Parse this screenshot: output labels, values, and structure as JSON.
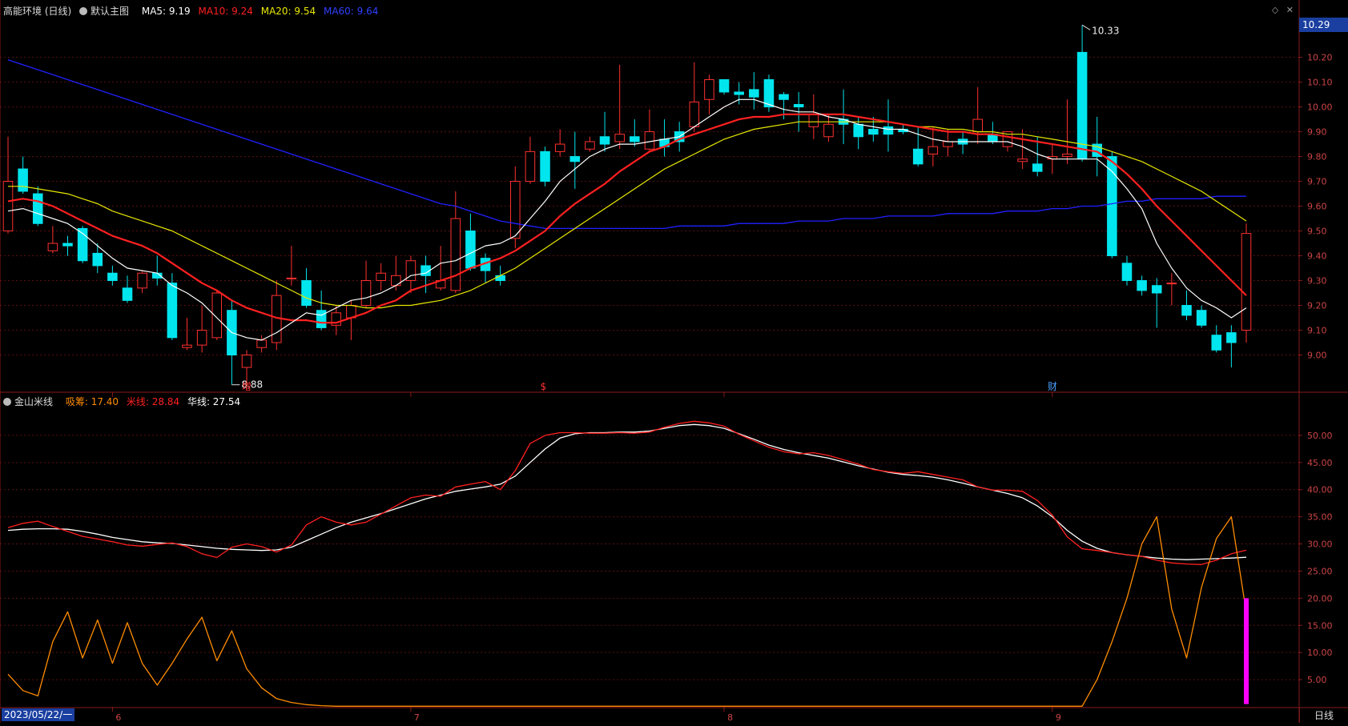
{
  "header": {
    "stock_title": "高能环境 (日线)",
    "main_chart_label": "默认主图",
    "ma5": {
      "label": "MA5: 9.19",
      "color": "#ffffff"
    },
    "ma10": {
      "label": "MA10: 9.24",
      "color": "#ff2020"
    },
    "ma20": {
      "label": "MA20: 9.54",
      "color": "#e8e800"
    },
    "ma60": {
      "label": "MA60: 9.64",
      "color": "#2020ff"
    }
  },
  "indicator_header": {
    "name": "金山米线",
    "xichou": {
      "label": "吸筹: 17.40",
      "color": "#ff8c00"
    },
    "mixian": {
      "label": "米线: 28.84",
      "color": "#ff2020"
    },
    "huaxian": {
      "label": "华线: 27.54",
      "color": "#ffffff"
    }
  },
  "price_axis_ticks": [
    "10.20",
    "10.10",
    "10.00",
    "9.90",
    "9.80",
    "9.70",
    "9.60",
    "9.50",
    "9.40",
    "9.30",
    "9.20",
    "9.10",
    "9.00"
  ],
  "indicator_axis_ticks": [
    "50.00",
    "45.00",
    "40.00",
    "35.00",
    "30.00",
    "25.00",
    "20.00",
    "15.00",
    "10.00",
    "5.00"
  ],
  "current_price_tag": "10.29",
  "annotations": {
    "high": "10.33",
    "low": "8.88"
  },
  "event_markers": [
    "增",
    "$",
    "财"
  ],
  "month_labels": [
    "6",
    "7",
    "8",
    "9"
  ],
  "date_label": "2023/05/22/一",
  "period_label": "日线",
  "colors": {
    "up": "#ff3030",
    "down": "#00e5ee",
    "grid": "#5a1010",
    "axis": "#8a1a1a",
    "bar": "#ff00ff"
  },
  "chart_data": {
    "type": "candlestick",
    "price_range": [
      8.85,
      10.36
    ],
    "candles": [
      [
        9.5,
        9.7,
        9.49,
        9.88
      ],
      [
        9.75,
        9.66,
        9.65,
        9.8
      ],
      [
        9.65,
        9.53,
        9.52,
        9.68
      ],
      [
        9.42,
        9.45,
        9.41,
        9.52
      ],
      [
        9.45,
        9.44,
        9.4,
        9.48
      ],
      [
        9.51,
        9.38,
        9.37,
        9.52
      ],
      [
        9.41,
        9.36,
        9.33,
        9.45
      ],
      [
        9.33,
        9.3,
        9.28,
        9.36
      ],
      [
        9.27,
        9.22,
        9.21,
        9.32
      ],
      [
        9.27,
        9.33,
        9.25,
        9.34
      ],
      [
        9.33,
        9.31,
        9.28,
        9.4
      ],
      [
        9.29,
        9.07,
        9.06,
        9.33
      ],
      [
        9.03,
        9.04,
        9.02,
        9.15
      ],
      [
        9.04,
        9.1,
        9.01,
        9.2
      ],
      [
        9.07,
        9.25,
        9.06,
        9.26
      ],
      [
        9.18,
        9.0,
        8.88,
        9.22
      ],
      [
        8.95,
        9.0,
        8.88,
        9.02
      ],
      [
        9.03,
        9.06,
        9.01,
        9.08
      ],
      [
        9.05,
        9.24,
        9.02,
        9.3
      ],
      [
        9.31,
        9.31,
        9.28,
        9.44
      ],
      [
        9.3,
        9.2,
        9.19,
        9.35
      ],
      [
        9.18,
        9.11,
        9.1,
        9.26
      ],
      [
        9.12,
        9.17,
        9.08,
        9.2
      ],
      [
        9.15,
        9.2,
        9.06,
        9.22
      ],
      [
        9.2,
        9.3,
        9.19,
        9.38
      ],
      [
        9.3,
        9.33,
        9.26,
        9.37
      ],
      [
        9.28,
        9.32,
        9.26,
        9.4
      ],
      [
        9.3,
        9.38,
        9.25,
        9.4
      ],
      [
        9.36,
        9.32,
        9.25,
        9.4
      ],
      [
        9.27,
        9.3,
        9.26,
        9.44
      ],
      [
        9.26,
        9.55,
        9.25,
        9.66
      ],
      [
        9.5,
        9.35,
        9.34,
        9.57
      ],
      [
        9.39,
        9.34,
        9.29,
        9.41
      ],
      [
        9.32,
        9.3,
        9.28,
        9.36
      ],
      [
        9.47,
        9.7,
        9.43,
        9.76
      ],
      [
        9.7,
        9.82,
        9.69,
        9.88
      ],
      [
        9.82,
        9.7,
        9.68,
        9.84
      ],
      [
        9.82,
        9.85,
        9.8,
        9.91
      ],
      [
        9.8,
        9.78,
        9.67,
        9.9
      ],
      [
        9.83,
        9.86,
        9.82,
        9.88
      ],
      [
        9.88,
        9.85,
        9.82,
        9.98
      ],
      [
        9.86,
        9.89,
        9.83,
        10.17
      ],
      [
        9.88,
        9.86,
        9.84,
        9.95
      ],
      [
        9.83,
        9.9,
        9.82,
        9.99
      ],
      [
        9.87,
        9.84,
        9.8,
        9.95
      ],
      [
        9.9,
        9.86,
        9.82,
        9.94
      ],
      [
        9.92,
        10.02,
        9.9,
        10.18
      ],
      [
        10.03,
        10.11,
        9.97,
        10.13
      ],
      [
        10.11,
        10.06,
        10.05,
        10.11
      ],
      [
        10.06,
        10.05,
        10.01,
        10.1
      ],
      [
        10.07,
        10.04,
        9.99,
        10.14
      ],
      [
        10.11,
        10.0,
        9.98,
        10.13
      ],
      [
        10.05,
        10.03,
        9.95,
        10.06
      ],
      [
        10.01,
        10.0,
        9.9,
        10.06
      ],
      [
        9.92,
        9.97,
        9.87,
        10.05
      ],
      [
        9.88,
        9.93,
        9.86,
        9.97
      ],
      [
        9.95,
        9.93,
        9.85,
        10.07
      ],
      [
        9.93,
        9.88,
        9.83,
        9.96
      ],
      [
        9.91,
        9.89,
        9.86,
        9.96
      ],
      [
        9.92,
        9.89,
        9.82,
        10.03
      ],
      [
        9.91,
        9.9,
        9.89,
        9.93
      ],
      [
        9.83,
        9.77,
        9.76,
        9.92
      ],
      [
        9.81,
        9.84,
        9.76,
        9.92
      ],
      [
        9.84,
        9.86,
        9.8,
        9.91
      ],
      [
        9.87,
        9.85,
        9.81,
        9.9
      ],
      [
        9.9,
        9.95,
        9.85,
        10.08
      ],
      [
        9.89,
        9.86,
        9.85,
        9.94
      ],
      [
        9.84,
        9.9,
        9.82,
        9.9
      ],
      [
        9.78,
        9.79,
        9.75,
        9.91
      ],
      [
        9.77,
        9.74,
        9.72,
        9.88
      ],
      [
        9.79,
        9.8,
        9.73,
        9.85
      ],
      [
        9.8,
        9.81,
        9.77,
        10.03
      ],
      [
        10.22,
        9.79,
        9.78,
        10.33
      ],
      [
        9.85,
        9.8,
        9.72,
        9.96
      ],
      [
        9.8,
        9.4,
        9.39,
        9.82
      ],
      [
        9.37,
        9.3,
        9.28,
        9.4
      ],
      [
        9.3,
        9.26,
        9.24,
        9.32
      ],
      [
        9.28,
        9.25,
        9.11,
        9.31
      ],
      [
        9.29,
        9.29,
        9.2,
        9.33
      ],
      [
        9.2,
        9.16,
        9.14,
        9.26
      ],
      [
        9.18,
        9.12,
        9.11,
        9.2
      ],
      [
        9.08,
        9.02,
        9.01,
        9.12
      ],
      [
        9.09,
        9.05,
        8.95,
        9.12
      ],
      [
        9.1,
        9.49,
        9.05,
        9.53
      ]
    ],
    "ma5": [
      9.58,
      9.59,
      9.57,
      9.55,
      9.53,
      9.49,
      9.44,
      9.39,
      9.35,
      9.34,
      9.33,
      9.28,
      9.25,
      9.21,
      9.15,
      9.09,
      9.07,
      9.06,
      9.09,
      9.13,
      9.17,
      9.16,
      9.19,
      9.22,
      9.23,
      9.25,
      9.28,
      9.32,
      9.33,
      9.37,
      9.38,
      9.41,
      9.44,
      9.45,
      9.48,
      9.55,
      9.62,
      9.7,
      9.75,
      9.8,
      9.83,
      9.85,
      9.85,
      9.86,
      9.87,
      9.88,
      9.92,
      9.96,
      10.0,
      10.03,
      10.03,
      10.01,
      9.99,
      9.98,
      9.98,
      9.96,
      9.95,
      9.93,
      9.92,
      9.91,
      9.91,
      9.89,
      9.87,
      9.86,
      9.86,
      9.86,
      9.86,
      9.86,
      9.84,
      9.81,
      9.79,
      9.79,
      9.79,
      9.79,
      9.74,
      9.67,
      9.59,
      9.45,
      9.35,
      9.27,
      9.22,
      9.19,
      9.15,
      9.19
    ],
    "ma10": [
      9.62,
      9.63,
      9.62,
      9.6,
      9.57,
      9.54,
      9.51,
      9.48,
      9.46,
      9.44,
      9.41,
      9.37,
      9.33,
      9.29,
      9.26,
      9.22,
      9.19,
      9.17,
      9.15,
      9.14,
      9.14,
      9.13,
      9.13,
      9.15,
      9.17,
      9.2,
      9.22,
      9.26,
      9.28,
      9.3,
      9.32,
      9.35,
      9.37,
      9.39,
      9.42,
      9.46,
      9.5,
      9.56,
      9.61,
      9.65,
      9.69,
      9.74,
      9.78,
      9.82,
      9.84,
      9.87,
      9.89,
      9.91,
      9.93,
      9.95,
      9.96,
      9.96,
      9.97,
      9.97,
      9.97,
      9.97,
      9.97,
      9.96,
      9.95,
      9.94,
      9.93,
      9.92,
      9.91,
      9.9,
      9.9,
      9.89,
      9.89,
      9.88,
      9.87,
      9.86,
      9.85,
      9.84,
      9.83,
      9.82,
      9.78,
      9.73,
      9.67,
      9.6,
      9.54,
      9.48,
      9.42,
      9.36,
      9.3,
      9.24
    ],
    "ma20": [
      9.68,
      9.68,
      9.67,
      9.66,
      9.65,
      9.63,
      9.61,
      9.58,
      9.56,
      9.54,
      9.52,
      9.5,
      9.47,
      9.44,
      9.41,
      9.38,
      9.35,
      9.32,
      9.29,
      9.26,
      9.23,
      9.21,
      9.2,
      9.2,
      9.19,
      9.19,
      9.2,
      9.2,
      9.21,
      9.22,
      9.24,
      9.26,
      9.29,
      9.32,
      9.35,
      9.39,
      9.43,
      9.47,
      9.51,
      9.55,
      9.59,
      9.63,
      9.67,
      9.71,
      9.75,
      9.78,
      9.81,
      9.84,
      9.87,
      9.89,
      9.91,
      9.92,
      9.93,
      9.94,
      9.94,
      9.94,
      9.94,
      9.94,
      9.94,
      9.94,
      9.93,
      9.92,
      9.92,
      9.91,
      9.91,
      9.9,
      9.9,
      9.89,
      9.89,
      9.88,
      9.87,
      9.86,
      9.85,
      9.84,
      9.82,
      9.8,
      9.78,
      9.75,
      9.72,
      9.69,
      9.66,
      9.62,
      9.58,
      9.54
    ],
    "ma60": [
      10.19,
      10.17,
      10.15,
      10.13,
      10.11,
      10.09,
      10.07,
      10.05,
      10.03,
      10.01,
      9.99,
      9.97,
      9.95,
      9.93,
      9.91,
      9.89,
      9.87,
      9.85,
      9.83,
      9.81,
      9.79,
      9.77,
      9.75,
      9.73,
      9.71,
      9.69,
      9.67,
      9.65,
      9.63,
      9.61,
      9.6,
      9.58,
      9.56,
      9.54,
      9.53,
      9.52,
      9.51,
      9.51,
      9.51,
      9.51,
      9.51,
      9.51,
      9.51,
      9.51,
      9.51,
      9.52,
      9.52,
      9.52,
      9.52,
      9.53,
      9.53,
      9.53,
      9.53,
      9.54,
      9.54,
      9.54,
      9.55,
      9.55,
      9.55,
      9.56,
      9.56,
      9.56,
      9.56,
      9.57,
      9.57,
      9.57,
      9.57,
      9.58,
      9.58,
      9.58,
      9.59,
      9.59,
      9.6,
      9.6,
      9.61,
      9.62,
      9.62,
      9.63,
      9.63,
      9.63,
      9.63,
      9.64,
      9.64,
      9.64
    ],
    "indicator_range": [
      0,
      55
    ],
    "mixian": [
      33.0,
      33.8,
      34.2,
      33.2,
      32.3,
      31.4,
      30.9,
      30.4,
      29.8,
      29.6,
      29.9,
      30.2,
      29.5,
      28.2,
      27.5,
      29.4,
      30.0,
      29.5,
      28.5,
      29.8,
      33.5,
      35.0,
      34.0,
      33.5,
      34.0,
      35.5,
      37.0,
      38.5,
      39.0,
      38.8,
      40.5,
      41.0,
      41.5,
      40.0,
      43.5,
      48.5,
      50.0,
      50.5,
      50.5,
      50.4,
      50.4,
      50.5,
      50.4,
      50.6,
      51.5,
      52.2,
      52.6,
      52.3,
      51.7,
      50.2,
      49.0,
      47.8,
      47.0,
      46.6,
      46.8,
      46.3,
      45.5,
      44.7,
      43.7,
      43.3,
      43.0,
      43.3,
      42.8,
      42.3,
      41.8,
      40.5,
      39.9,
      39.9,
      39.7,
      38.0,
      35.3,
      31.3,
      29.1,
      28.8,
      28.4,
      28.0,
      27.7,
      27.0,
      26.5,
      26.3,
      26.2,
      27.0,
      28.2,
      28.84
    ],
    "huaxian": [
      32.5,
      32.7,
      32.8,
      32.8,
      32.7,
      32.3,
      31.8,
      31.2,
      30.8,
      30.4,
      30.2,
      30.1,
      29.8,
      29.5,
      29.2,
      29.0,
      28.9,
      28.8,
      28.9,
      29.4,
      30.6,
      31.8,
      33.0,
      34.0,
      34.8,
      35.6,
      36.5,
      37.4,
      38.3,
      39.0,
      39.7,
      40.1,
      40.5,
      41.0,
      42.5,
      45.0,
      47.5,
      49.5,
      50.3,
      50.5,
      50.5,
      50.6,
      50.6,
      50.8,
      51.3,
      51.8,
      52.0,
      51.8,
      51.3,
      50.3,
      49.3,
      48.2,
      47.4,
      46.8,
      46.3,
      45.8,
      45.1,
      44.4,
      43.8,
      43.2,
      42.8,
      42.6,
      42.3,
      41.8,
      41.2,
      40.5,
      39.9,
      39.3,
      38.5,
      37.0,
      35.0,
      32.5,
      30.5,
      29.2,
      28.4,
      28.0,
      27.7,
      27.4,
      27.2,
      27.1,
      27.2,
      27.3,
      27.4,
      27.54
    ],
    "xichou": [
      6.0,
      3.0,
      2.0,
      12.0,
      17.5,
      9.0,
      16.0,
      8.0,
      15.5,
      8.0,
      4.0,
      8.0,
      12.5,
      16.5,
      8.5,
      14.0,
      7.0,
      3.5,
      1.5,
      0.8,
      0.4,
      0.2,
      0.1,
      0.1,
      0.1,
      0.1,
      0.1,
      0.1,
      0.1,
      0.1,
      0.1,
      0.1,
      0.1,
      0.1,
      0.1,
      0.1,
      0.1,
      0.1,
      0.1,
      0.1,
      0.1,
      0.1,
      0.1,
      0.1,
      0.1,
      0.1,
      0.1,
      0.1,
      0.1,
      0.1,
      0.1,
      0.1,
      0.1,
      0.1,
      0.1,
      0.1,
      0.1,
      0.1,
      0.1,
      0.1,
      0.1,
      0.1,
      0.1,
      0.1,
      0.1,
      0.1,
      0.1,
      0.1,
      0.1,
      0.1,
      0.1,
      0.1,
      0.1,
      5.0,
      12.0,
      20.0,
      30.0,
      35.0,
      18.0,
      9.0,
      22.0,
      31.0,
      35.0,
      17.4
    ],
    "last_bar_value": 20.0
  }
}
